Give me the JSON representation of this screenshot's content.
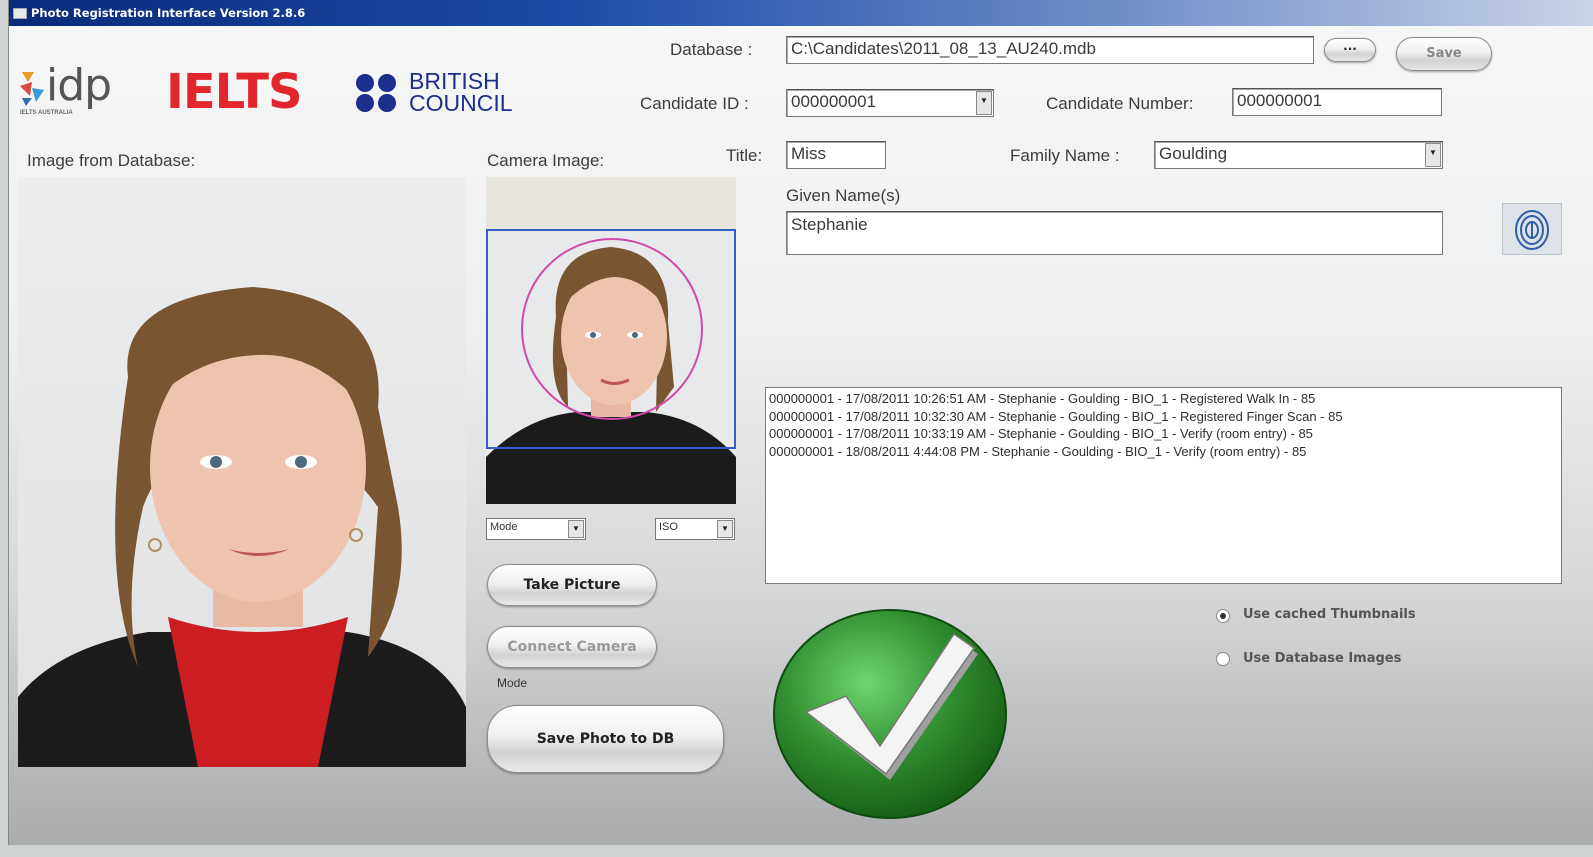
{
  "window": {
    "title": "Photo Registration Interface  Version 2.8.6"
  },
  "logos": {
    "idp": "idp",
    "idp_sub": "IELTS AUSTRALIA",
    "ielts": "IELTS",
    "british_line1": "BRITISH",
    "british_line2": "COUNCIL"
  },
  "database": {
    "label": "Database :",
    "value": "C:\\Candidates\\2011_08_13_AU240.mdb",
    "browse_label": "...",
    "save_label": "Save"
  },
  "candidate_id": {
    "label": "Candidate ID :",
    "value": "000000001"
  },
  "candidate_number": {
    "label": "Candidate Number:",
    "value": "000000001"
  },
  "title_field": {
    "label": "Title:",
    "value": "Miss"
  },
  "family_name": {
    "label": "Family Name :",
    "value": "Goulding"
  },
  "given_names": {
    "label": "Given Name(s)",
    "value": "Stephanie"
  },
  "image_db": {
    "label": "Image from Database:"
  },
  "camera": {
    "label": "Camera Image:",
    "mode_value": "Mode",
    "iso_value": "ISO",
    "mode_label": "Mode"
  },
  "buttons": {
    "take_picture": "Take Picture",
    "connect_camera": "Connect Camera",
    "save_photo": "Save Photo to DB"
  },
  "log_entries": [
    "000000001 - 17/08/2011 10:26:51 AM - Stephanie - Goulding - BIO_1 - Registered Walk In -  85",
    "000000001 - 17/08/2011 10:32:30 AM - Stephanie - Goulding - BIO_1 - Registered Finger Scan -  85",
    "000000001 - 17/08/2011 10:33:19 AM - Stephanie - Goulding - BIO_1 - Verify (room entry) -  85",
    "000000001 - 18/08/2011 4:44:08 PM - Stephanie - Goulding - BIO_1 - Verify (room entry) -  85"
  ],
  "options": {
    "cached": "Use cached Thumbnails",
    "db_images": "Use Database Images",
    "selected": "cached"
  },
  "icons": {
    "fingerprint": "fingerprint-icon",
    "status": "check-icon"
  },
  "colors": {
    "ielts_red": "#e3262e",
    "british_blue": "#1d2f8c",
    "check_green": "#2e8b2e",
    "title_bar": "#0a2a7a"
  }
}
